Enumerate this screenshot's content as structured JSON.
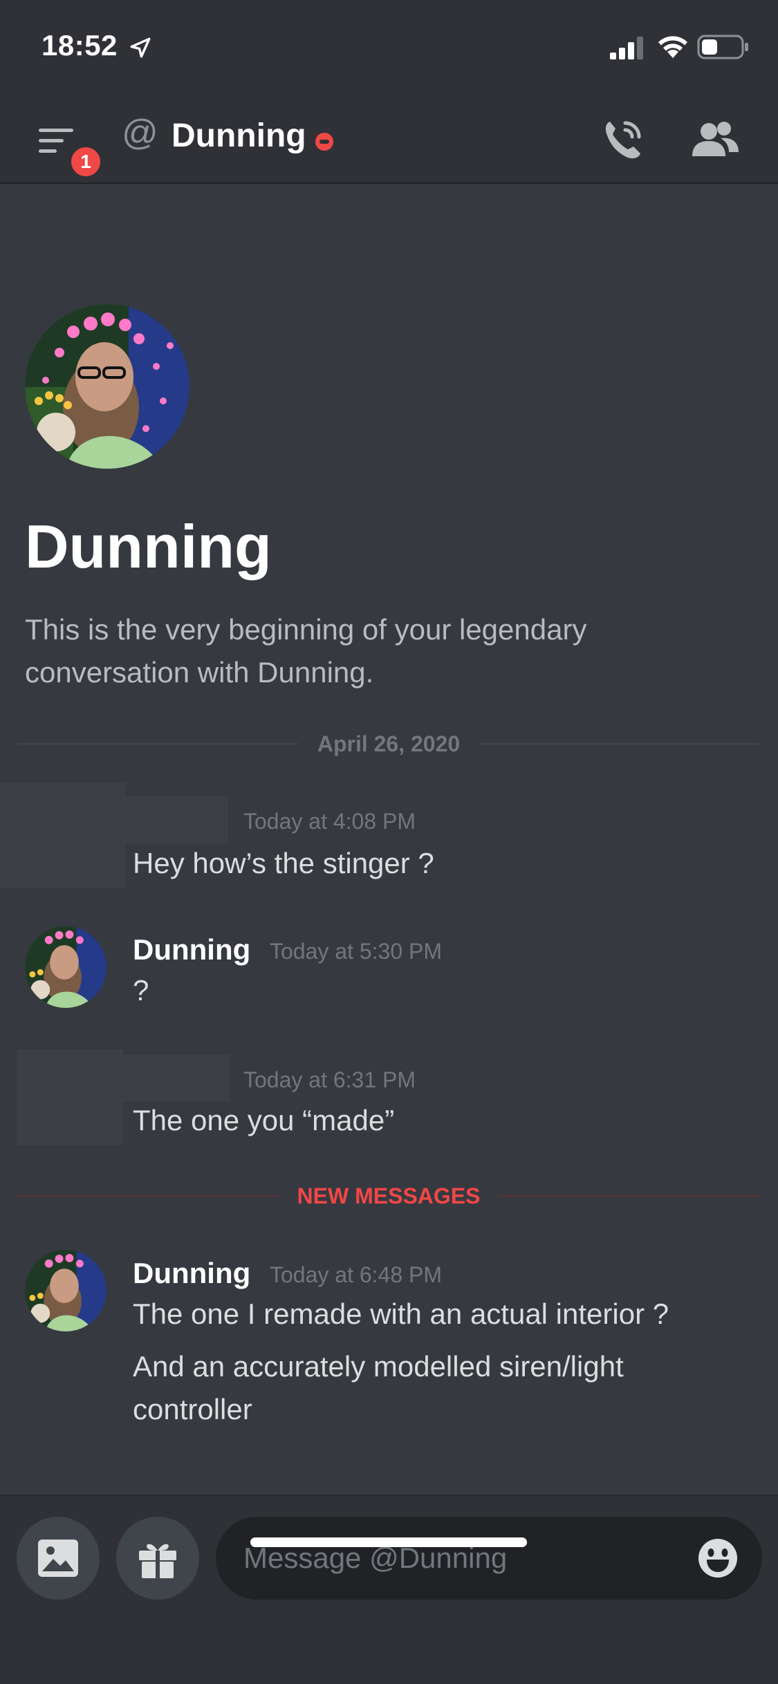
{
  "status_bar": {
    "time": "18:52"
  },
  "header": {
    "badge_count": "1",
    "at_symbol": "@",
    "title": "Dunning"
  },
  "intro": {
    "name": "Dunning",
    "text": "This is the very beginning of your legendary conversation with Dunning."
  },
  "date_divider": "April 26, 2020",
  "new_divider": "NEW MESSAGES",
  "messages": [
    {
      "author": "",
      "time": "Today at 4:08 PM",
      "lines": [
        "Hey how’s the stinger ?"
      ]
    },
    {
      "author": "Dunning",
      "time": "Today at 5:30 PM",
      "lines": [
        "?"
      ]
    },
    {
      "author": "",
      "time": "Today at 6:31 PM",
      "lines": [
        "The one you “made”"
      ]
    },
    {
      "author": "Dunning",
      "time": "Today at 6:48 PM",
      "lines": [
        "The one I remade with an actual interior ?",
        "And an accurately modelled siren/light controller"
      ]
    }
  ],
  "composer": {
    "placeholder": "Message @Dunning"
  },
  "colors": {
    "background": "#36393f",
    "header": "#2f3136",
    "dnd_status": "#f04747",
    "new_messages": "#f04747"
  }
}
